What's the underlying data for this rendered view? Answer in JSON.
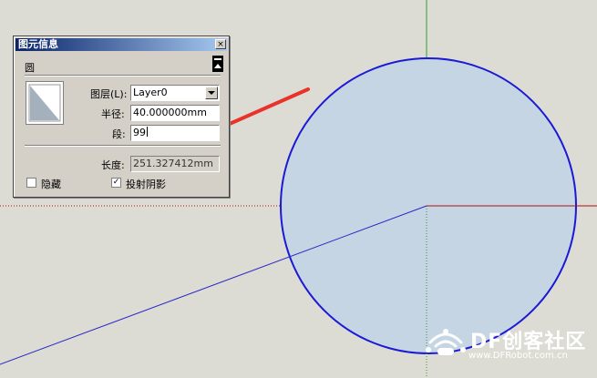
{
  "colors": {
    "canvas_bg": "#dcdcd5",
    "circle_fill": "#c6d5e3",
    "circle_stroke": "#1a1ad6",
    "blue_axis": "#2a2ac8",
    "green_axis": "#2ca02c",
    "red_axis": "#b01010",
    "arrow": "#e8322a",
    "titlebar": "#0a246a"
  },
  "panel": {
    "title": "图元信息",
    "close_glyph": "×",
    "entity_type": "圆",
    "layer_label": "图层(L):",
    "layer_value": "Layer0",
    "radius_label": "半径:",
    "radius_value": "40.000000mm",
    "segments_label": "段:",
    "segments_value": "99",
    "length_label": "长度:",
    "length_value": "251.327412mm",
    "hidden_label": "隐藏",
    "hidden_checked": false,
    "cast_shadow_label": "投射阴影",
    "cast_shadow_checked": true
  },
  "watermark": {
    "brand": "DF创客社区",
    "url": "www.DFRobot.com.cn"
  }
}
